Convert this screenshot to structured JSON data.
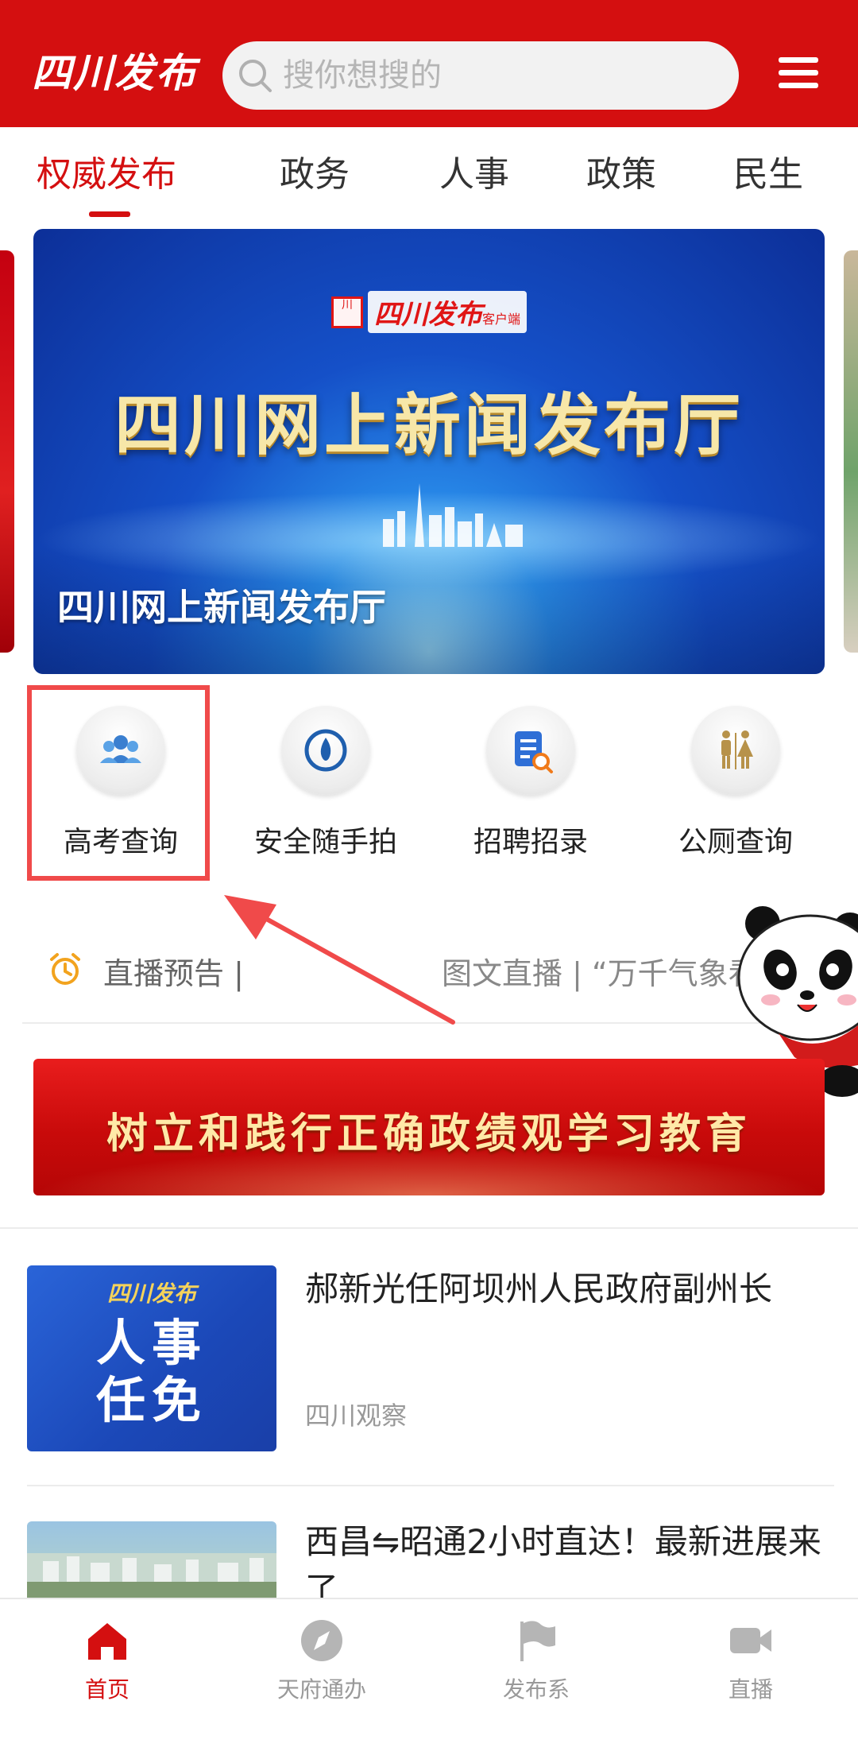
{
  "header": {
    "logo_text": "四川发布",
    "search_placeholder": "搜你想搜的"
  },
  "tabs": [
    {
      "label": "权威发布",
      "active": true
    },
    {
      "label": "政务",
      "active": false
    },
    {
      "label": "人事",
      "active": false
    },
    {
      "label": "政策",
      "active": false
    },
    {
      "label": "民生",
      "active": false
    }
  ],
  "banner": {
    "brand": "四川发布",
    "brand_suffix": "客户端",
    "seal": "川",
    "headline": "四川网上新闻发布厅",
    "caption": "四川网上新闻发布厅"
  },
  "services": [
    {
      "label": "高考查询",
      "icon": "people-icon"
    },
    {
      "label": "安全随手拍",
      "icon": "flame-icon"
    },
    {
      "label": "招聘招录",
      "icon": "document-search-icon"
    },
    {
      "label": "公厕查询",
      "icon": "restroom-icon"
    }
  ],
  "live": {
    "label": "直播预告 |",
    "text": "图文直播 | “万千气象看"
  },
  "promo": {
    "text": "树立和践行正确政绩观学习教育"
  },
  "news": [
    {
      "title": "郝新光任阿坝州人民政府副州长",
      "source": "四川观察",
      "thumb_brand": "四川发布",
      "thumb_line1": "人事",
      "thumb_line2": "任免"
    },
    {
      "title": "西昌⇋昭通2小时直达！最新进展来了",
      "source": ""
    }
  ],
  "bottom_nav": [
    {
      "label": "首页",
      "icon": "home-icon",
      "active": true
    },
    {
      "label": "天府通办",
      "icon": "compass-icon",
      "active": false
    },
    {
      "label": "发布系",
      "icon": "flag-icon",
      "active": false
    },
    {
      "label": "直播",
      "icon": "video-icon",
      "active": false
    }
  ],
  "colors": {
    "brand_red": "#d40f10",
    "highlight_red": "#f04a4a"
  }
}
